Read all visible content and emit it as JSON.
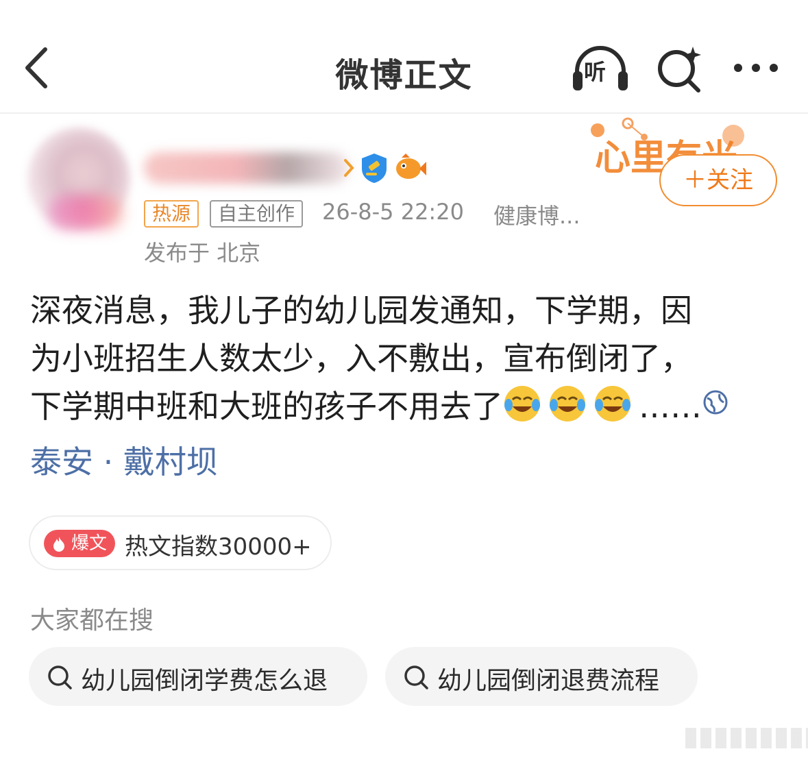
{
  "header": {
    "title": "微博正文",
    "listen_label": "听"
  },
  "author": {
    "tags": {
      "hot_source": "热源",
      "original": "自主创作"
    },
    "time": "26-8-5 22:20",
    "source": "健康博...",
    "location_line": "发布于 北京",
    "follow_label": "＋关注",
    "decoration_text": "心里有光"
  },
  "post": {
    "lines": [
      "深夜消息，我儿子的幼儿园发通知，下学期，因",
      "为小班招生人数太少，入不敷出，宣布倒闭了，",
      "下学期中班和大班的孩子不用去了"
    ],
    "ellipsis": "……",
    "location_tag": "泰安 · 戴村坝"
  },
  "hot": {
    "badge_label": "爆文",
    "index_text": "热文指数30000+"
  },
  "search": {
    "heading": "大家都在搜",
    "chips": [
      "幼儿园倒闭学费怎么退",
      "幼儿园倒闭退费流程"
    ]
  },
  "colors": {
    "accent_orange": "#f07a1a",
    "hot_red": "#f0545a",
    "link_blue": "#4d6fa6",
    "meta_gray": "#8a8a8a"
  },
  "icons": [
    "back-chevron-icon",
    "listen-headphones-icon",
    "search-sparkle-icon",
    "more-dots-icon",
    "verified-icon",
    "fish-icon",
    "crying-laughing-emoji",
    "globe-icon",
    "search-icon",
    "flame-icon"
  ]
}
